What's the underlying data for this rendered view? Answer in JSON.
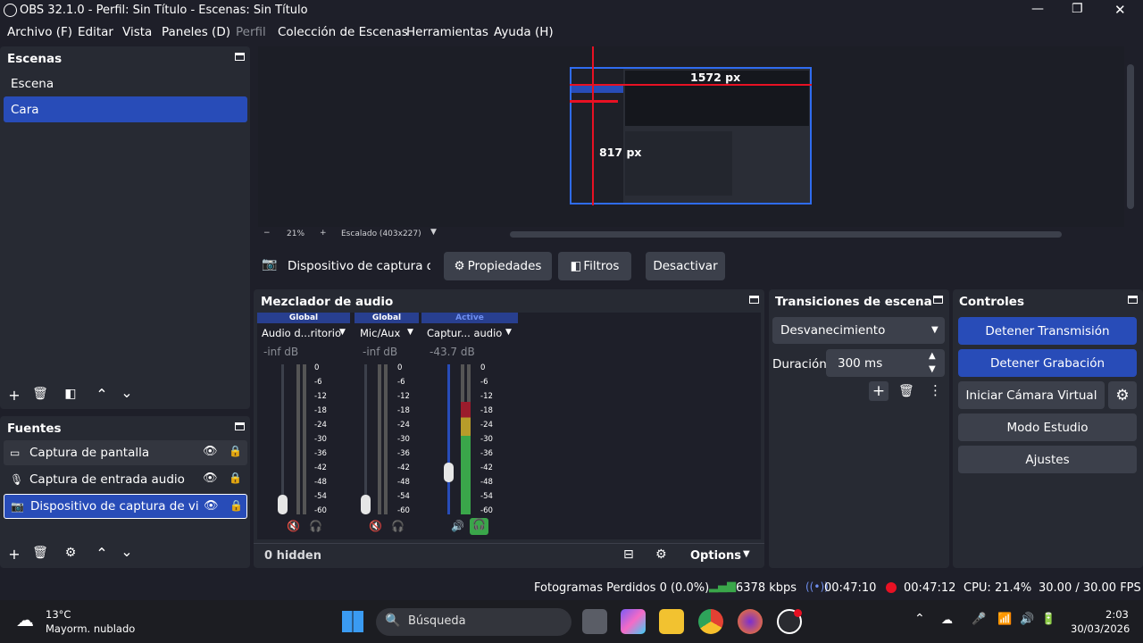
{
  "window": {
    "title": "OBS 32.1.0 - Perfil: Sin Título - Escenas: Sin Título",
    "controls": {
      "minimize": "—",
      "maximize": "❐",
      "close": "✕"
    }
  },
  "menu": [
    "Archivo (F)",
    "Editar",
    "Vista",
    "Paneles (D)",
    "Perfil",
    "Colección de Escenas",
    "Herramientas",
    "Ayuda (H)"
  ],
  "scenes": {
    "title": "Escenas",
    "items": [
      "Escena",
      "Cara"
    ],
    "selected": 1
  },
  "preview": {
    "width_label": "1572 px",
    "height_label": "817 px",
    "zoom": "21%",
    "scale_label": "Escalado (403x227)",
    "minus": "−",
    "plus": "+"
  },
  "source_toolbar": {
    "device": "Dispositivo de captura de v",
    "properties": "Propiedades",
    "filters": "Filtros",
    "deactivate": "Desactivar"
  },
  "sources": {
    "title": "Fuentes",
    "items": [
      {
        "label": "Captura de pantalla",
        "icon": "monitor-icon"
      },
      {
        "label": "Captura de entrada audio",
        "icon": "microphone-icon"
      },
      {
        "label": "Dispositivo de captura de video",
        "icon": "camera-icon"
      }
    ],
    "selected": 2
  },
  "mixer": {
    "title": "Mezclador de audio",
    "channels": [
      {
        "tag": "Global",
        "name": "Audio d...ritorio",
        "db": "-inf dB",
        "level": 0.0,
        "fader": 0.0
      },
      {
        "tag": "Global",
        "name": "Mic/Aux",
        "db": "-inf dB",
        "level": 0.0,
        "fader": 0.0
      },
      {
        "tag": "Active",
        "name": "Captur... audio",
        "db": "-43.7 dB",
        "level": 0.75,
        "fader": 0.25
      }
    ],
    "ticks": [
      "0",
      "-6",
      "-12",
      "-18",
      "-24",
      "-30",
      "-36",
      "-42",
      "-48",
      "-54",
      "-60"
    ],
    "hidden": "0 hidden",
    "options": "Options"
  },
  "transitions": {
    "title": "Transiciones de escena",
    "type": "Desvanecimiento",
    "duration_label": "Duración",
    "duration": "300 ms"
  },
  "controls": {
    "title": "Controles",
    "stop_stream": "Detener Transmisión",
    "stop_record": "Detener Grabación",
    "virtual_cam": "Iniciar Cámara Virtual",
    "studio": "Modo Estudio",
    "settings": "Ajustes"
  },
  "status": {
    "dropped": "Fotogramas Perdidos 0 (0.0%)",
    "bitrate": "6378 kbps",
    "stream_time": "00:47:10",
    "rec_time": "00:47:12",
    "cpu": "CPU: 21.4%",
    "fps": "30.00 / 30.00 FPS"
  },
  "taskbar": {
    "temp": "13°C",
    "weather": "Mayorm. nublado",
    "search": "Búsqueda",
    "time": "2:03",
    "date": "30/03/2026"
  },
  "colors": {
    "bg": "#1e1f29",
    "panel": "#272a33",
    "button": "#3c404b",
    "accent": "#284cb8",
    "record": "#e81123",
    "meter_green": "#3aa64a"
  }
}
